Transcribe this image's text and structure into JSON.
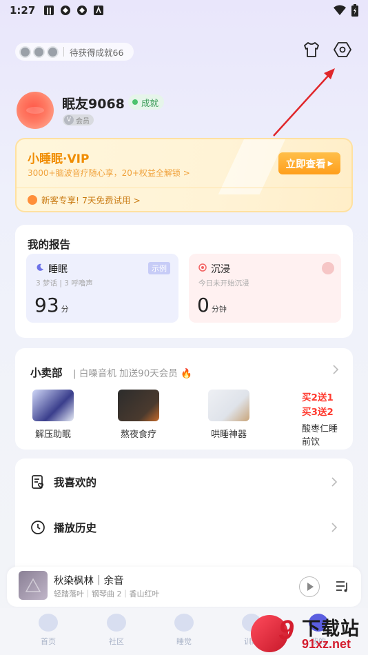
{
  "status_bar": {
    "time": "1:27"
  },
  "profile": {
    "achievement_pill": "待获得成就66",
    "username": "眠友9068",
    "achievement_tag": "成就",
    "member_label": "会员"
  },
  "vip": {
    "title": "小睡眠·VIP",
    "subtitle": "3000+脑波音疗随心享，20+权益全解锁 >",
    "button": "立即查看",
    "trial": "新客专享! 7天免费试用 >"
  },
  "report": {
    "title": "我的报告",
    "sleep": {
      "label": "睡眠",
      "tag": "示例",
      "sub": "3 梦话 | 3 呼噜声",
      "value": "93",
      "unit": "分"
    },
    "immerse": {
      "label": "沉浸",
      "sub": "今日未开始沉浸",
      "value": "0",
      "unit": "分钟"
    }
  },
  "shop": {
    "title": "小卖部",
    "subtitle": "| 白噪音机 加送90天会员 🔥",
    "items": [
      {
        "label": "解压助眠"
      },
      {
        "label": "熬夜食疗"
      },
      {
        "label": "哄睡神器"
      }
    ],
    "promo_line1": "买2送1",
    "promo_line2": "买3送2",
    "promo_label": "酸枣仁睡前饮"
  },
  "list": {
    "favorites": "我喜欢的",
    "history": "播放历史"
  },
  "player": {
    "title": "秋染枫林｜余音",
    "subtitle": "轻踏落叶｜钢琴曲 2｜香山红叶"
  },
  "tabs": [
    {
      "label": "首页"
    },
    {
      "label": "社区"
    },
    {
      "label": "睡觉"
    },
    {
      "label": "训练"
    },
    {
      "label": "我的"
    }
  ],
  "watermark": {
    "brand": "下载站",
    "num": "9",
    "url": "91xz.net"
  },
  "colors": {
    "vip_orange": "#f08c00",
    "accent_red": "#e0262a",
    "achievement_green": "#3b9b58"
  }
}
